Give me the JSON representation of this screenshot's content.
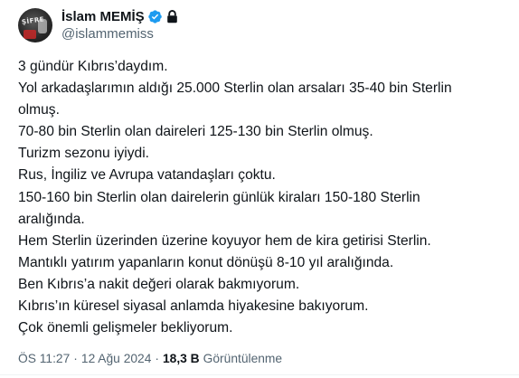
{
  "author": {
    "display_name": "İslam MEMİŞ",
    "handle": "@islammemiss",
    "avatar_text": "ŞİFRE",
    "verified": true,
    "protected": true,
    "verified_color": "#1d9bf0"
  },
  "tweet": {
    "lines": [
      "3 gündür Kıbrıs’daydım.",
      "Yol arkadaşlarımın aldığı 25.000 Sterlin olan arsaları 35-40 bin Sterlin",
      "olmuş.",
      "70-80 bin Sterlin olan daireleri 125-130 bin Sterlin olmuş.",
      "Turizm sezonu iyiydi.",
      "Rus, İngiliz ve Avrupa vatandaşları çoktu.",
      "150-160 bin Sterlin olan dairelerin günlük kiraları 150-180 Sterlin",
      "aralığında.",
      "Hem Sterlin üzerinden üzerine koyuyor hem de kira getirisi Sterlin.",
      "Mantıklı yatırım yapanların konut dönüşü 8-10 yıl aralığında.",
      "Ben Kıbrıs’a nakit değeri olarak bakmıyorum.",
      "Kıbrıs’ın küresel siyasal anlamda hiyakesine bakıyorum.",
      "Çok önemli gelişmeler bekliyorum."
    ]
  },
  "meta": {
    "time": "ÖS 11:27",
    "separator": "·",
    "date": "12 Ağu 2024",
    "views_count": "18,3 B",
    "views_label": "Görüntülenme"
  }
}
